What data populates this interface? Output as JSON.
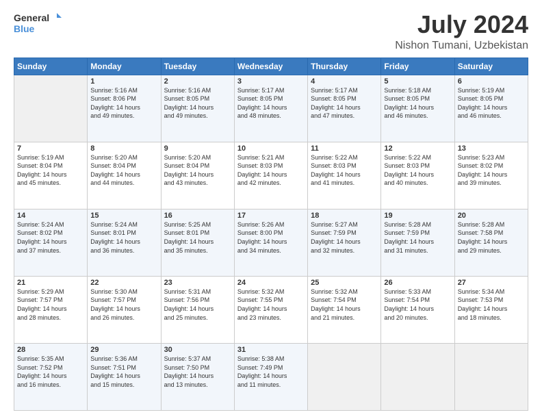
{
  "header": {
    "logo_line1": "General",
    "logo_line2": "Blue",
    "title": "July 2024",
    "subtitle": "Nishon Tumani, Uzbekistan"
  },
  "days_of_week": [
    "Sunday",
    "Monday",
    "Tuesday",
    "Wednesday",
    "Thursday",
    "Friday",
    "Saturday"
  ],
  "weeks": [
    [
      {
        "day": "",
        "info": ""
      },
      {
        "day": "1",
        "info": "Sunrise: 5:16 AM\nSunset: 8:06 PM\nDaylight: 14 hours\nand 49 minutes."
      },
      {
        "day": "2",
        "info": "Sunrise: 5:16 AM\nSunset: 8:05 PM\nDaylight: 14 hours\nand 49 minutes."
      },
      {
        "day": "3",
        "info": "Sunrise: 5:17 AM\nSunset: 8:05 PM\nDaylight: 14 hours\nand 48 minutes."
      },
      {
        "day": "4",
        "info": "Sunrise: 5:17 AM\nSunset: 8:05 PM\nDaylight: 14 hours\nand 47 minutes."
      },
      {
        "day": "5",
        "info": "Sunrise: 5:18 AM\nSunset: 8:05 PM\nDaylight: 14 hours\nand 46 minutes."
      },
      {
        "day": "6",
        "info": "Sunrise: 5:19 AM\nSunset: 8:05 PM\nDaylight: 14 hours\nand 46 minutes."
      }
    ],
    [
      {
        "day": "7",
        "info": "Sunrise: 5:19 AM\nSunset: 8:04 PM\nDaylight: 14 hours\nand 45 minutes."
      },
      {
        "day": "8",
        "info": "Sunrise: 5:20 AM\nSunset: 8:04 PM\nDaylight: 14 hours\nand 44 minutes."
      },
      {
        "day": "9",
        "info": "Sunrise: 5:20 AM\nSunset: 8:04 PM\nDaylight: 14 hours\nand 43 minutes."
      },
      {
        "day": "10",
        "info": "Sunrise: 5:21 AM\nSunset: 8:03 PM\nDaylight: 14 hours\nand 42 minutes."
      },
      {
        "day": "11",
        "info": "Sunrise: 5:22 AM\nSunset: 8:03 PM\nDaylight: 14 hours\nand 41 minutes."
      },
      {
        "day": "12",
        "info": "Sunrise: 5:22 AM\nSunset: 8:03 PM\nDaylight: 14 hours\nand 40 minutes."
      },
      {
        "day": "13",
        "info": "Sunrise: 5:23 AM\nSunset: 8:02 PM\nDaylight: 14 hours\nand 39 minutes."
      }
    ],
    [
      {
        "day": "14",
        "info": "Sunrise: 5:24 AM\nSunset: 8:02 PM\nDaylight: 14 hours\nand 37 minutes."
      },
      {
        "day": "15",
        "info": "Sunrise: 5:24 AM\nSunset: 8:01 PM\nDaylight: 14 hours\nand 36 minutes."
      },
      {
        "day": "16",
        "info": "Sunrise: 5:25 AM\nSunset: 8:01 PM\nDaylight: 14 hours\nand 35 minutes."
      },
      {
        "day": "17",
        "info": "Sunrise: 5:26 AM\nSunset: 8:00 PM\nDaylight: 14 hours\nand 34 minutes."
      },
      {
        "day": "18",
        "info": "Sunrise: 5:27 AM\nSunset: 7:59 PM\nDaylight: 14 hours\nand 32 minutes."
      },
      {
        "day": "19",
        "info": "Sunrise: 5:28 AM\nSunset: 7:59 PM\nDaylight: 14 hours\nand 31 minutes."
      },
      {
        "day": "20",
        "info": "Sunrise: 5:28 AM\nSunset: 7:58 PM\nDaylight: 14 hours\nand 29 minutes."
      }
    ],
    [
      {
        "day": "21",
        "info": "Sunrise: 5:29 AM\nSunset: 7:57 PM\nDaylight: 14 hours\nand 28 minutes."
      },
      {
        "day": "22",
        "info": "Sunrise: 5:30 AM\nSunset: 7:57 PM\nDaylight: 14 hours\nand 26 minutes."
      },
      {
        "day": "23",
        "info": "Sunrise: 5:31 AM\nSunset: 7:56 PM\nDaylight: 14 hours\nand 25 minutes."
      },
      {
        "day": "24",
        "info": "Sunrise: 5:32 AM\nSunset: 7:55 PM\nDaylight: 14 hours\nand 23 minutes."
      },
      {
        "day": "25",
        "info": "Sunrise: 5:32 AM\nSunset: 7:54 PM\nDaylight: 14 hours\nand 21 minutes."
      },
      {
        "day": "26",
        "info": "Sunrise: 5:33 AM\nSunset: 7:54 PM\nDaylight: 14 hours\nand 20 minutes."
      },
      {
        "day": "27",
        "info": "Sunrise: 5:34 AM\nSunset: 7:53 PM\nDaylight: 14 hours\nand 18 minutes."
      }
    ],
    [
      {
        "day": "28",
        "info": "Sunrise: 5:35 AM\nSunset: 7:52 PM\nDaylight: 14 hours\nand 16 minutes."
      },
      {
        "day": "29",
        "info": "Sunrise: 5:36 AM\nSunset: 7:51 PM\nDaylight: 14 hours\nand 15 minutes."
      },
      {
        "day": "30",
        "info": "Sunrise: 5:37 AM\nSunset: 7:50 PM\nDaylight: 14 hours\nand 13 minutes."
      },
      {
        "day": "31",
        "info": "Sunrise: 5:38 AM\nSunset: 7:49 PM\nDaylight: 14 hours\nand 11 minutes."
      },
      {
        "day": "",
        "info": ""
      },
      {
        "day": "",
        "info": ""
      },
      {
        "day": "",
        "info": ""
      }
    ]
  ]
}
